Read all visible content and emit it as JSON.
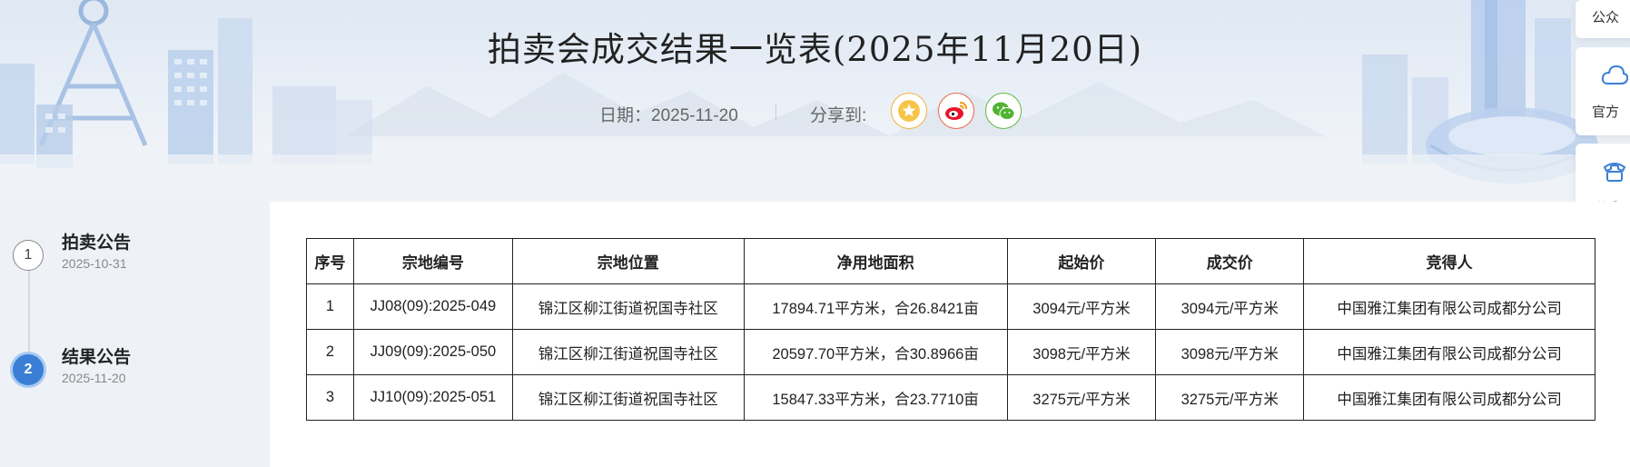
{
  "header": {
    "title": "拍卖会成交结果一览表(2025年11月20日)",
    "date_label": "日期：2025-11-20",
    "share_label": "分享到:",
    "share_buttons": [
      {
        "icon": "star-icon",
        "color": "#f0b43c"
      },
      {
        "icon": "weibo-icon",
        "color": "#e8684a"
      },
      {
        "icon": "wechat-icon",
        "color": "#62b848"
      }
    ]
  },
  "side_panel": {
    "items": [
      {
        "label": "公众",
        "icon": "qrcode-icon"
      },
      {
        "label": "官方",
        "icon": "cloud-icon"
      },
      {
        "label": "联系",
        "icon": "phone-icon"
      }
    ]
  },
  "timeline": {
    "steps": [
      {
        "number": "1",
        "title": "拍卖公告",
        "date": "2025-10-31",
        "active": false
      },
      {
        "number": "2",
        "title": "结果公告",
        "date": "2025-11-20",
        "active": true
      }
    ],
    "active_color": "#3a7fd5"
  },
  "table": {
    "headers": [
      "序号",
      "宗地编号",
      "宗地位置",
      "净用地面积",
      "起始价",
      "成交价",
      "竞得人"
    ],
    "rows": [
      [
        "1",
        "JJ08(09):2025-049",
        "锦江区柳江街道祝国寺社区",
        "17894.71平方米，合26.8421亩",
        "3094元/平方米",
        "3094元/平方米",
        "中国雅江集团有限公司成都分公司"
      ],
      [
        "2",
        "JJ09(09):2025-050",
        "锦江区柳江街道祝国寺社区",
        "20597.70平方米，合30.8966亩",
        "3098元/平方米",
        "3098元/平方米",
        "中国雅江集团有限公司成都分公司"
      ],
      [
        "3",
        "JJ10(09):2025-051",
        "锦江区柳江街道祝国寺社区",
        "15847.33平方米，合23.7710亩",
        "3275元/平方米",
        "3275元/平方米",
        "中国雅江集团有限公司成都分公司"
      ]
    ]
  }
}
